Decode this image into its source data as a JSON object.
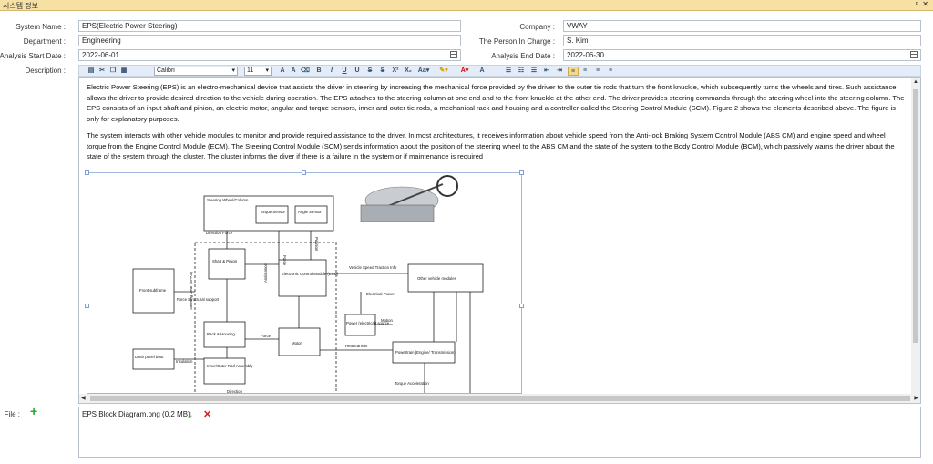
{
  "window": {
    "title": "시스템 정보",
    "pin_icon": "pin-icon",
    "close_icon": "close-icon"
  },
  "form": {
    "system_name_label": "System Name :",
    "system_name_value": "EPS(Electric Power Steering)",
    "company_label": "Company :",
    "company_value": "VWAY",
    "department_label": "Department :",
    "department_value": "Engineering",
    "person_label": "The Person In Charge :",
    "person_value": "S. Kim",
    "start_label": "Analysis Start Date :",
    "start_value": "2022-06-01",
    "end_label": "Analysis End Date :",
    "end_value": "2022-06-30",
    "description_label": "Description :",
    "file_label": "File :"
  },
  "toolbar": {
    "font": "Calibri",
    "size": "11"
  },
  "description": {
    "paragraph1": "Electric Power Steering (EPS) is an electro-mechanical device that assists the driver in steering by increasing the mechanical force provided by the driver to the outer tie rods that turn the front knuckle, which subsequently turns the wheels and tires. Such assistance allows the driver to provide desired direction to the vehicle during operation. The EPS attaches to the steering column at one end and to the front knuckle at the other end. The driver provides steering commands through the steering wheel into the steering column. The EPS consists of an input shaft and pinion, an electric motor, angular and torque sensors, inner and outer tie rods, a mechanical rack and housing and a controller called the Steering Control Module (SCM). Figure 2 shows the elements described above. The figure is only for explanatory purposes.",
    "paragraph2": " The system interacts with other vehicle modules to monitor and provide required assistance to the driver. In most architectures, it receives information about vehicle speed from the Anti-lock Braking System Control Module (ABS CM) and engine speed and wheel torque from the Engine Control Module (ECM). The Steering Control Module (SCM) sends information about the position of the steering wheel to the ABS CM and the state of the system to the Body Control Module (BCM), which passively warns the driver about the state of the system through the cluster. The cluster informs the diver if there is a failure in the system or if maintenance is required"
  },
  "diagram": {
    "steering_wheel": "Steering Wheel/Column",
    "torque_sensor": "Torque Sensor",
    "angle_sensor": "Angle Sensor",
    "direction_force": "Direction Force",
    "force": "Force",
    "position": "Position",
    "steering_gear": "Steering Gear (EPAS)",
    "shaft_pinion": "Shaft & Pinion",
    "assistance": "Assistance",
    "ecu": "Electronic Control Module (ECU)",
    "vehicle_speed": "Vehicle Speed Traction Info",
    "other_modules": "Other vehicle modules",
    "front_subframe": "Front subframe",
    "force_structural": "Force Structural support",
    "electrical_power": "Electrical Power",
    "rack_housing": "Rack & Housing",
    "power_source": "Power (electrical) source",
    "motion": "Motion",
    "motor": "Motor",
    "dash_panel": "Dash panel boot",
    "insulation": "Insulation",
    "inner_outer": "Inner/Outer Rod Assembly",
    "heat_transfer": "Heat transfer",
    "powertrain": "Powertrain (Engine/ Transmission)",
    "torque_accel": "Torque Acceleration",
    "direction": "Direction"
  },
  "attachments": [
    {
      "name": "EPS Block Diagram.png (0.2 MB)"
    }
  ]
}
